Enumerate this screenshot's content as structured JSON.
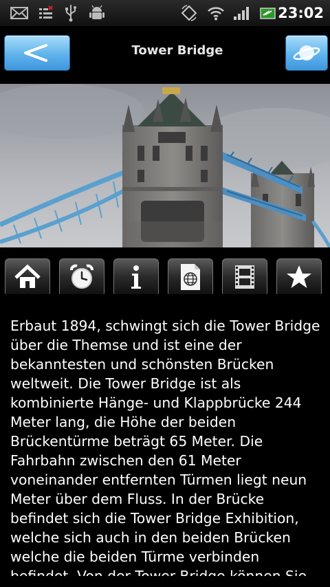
{
  "status_bar": {
    "time": "23:02",
    "icons": [
      "mail-icon",
      "notification-icon",
      "usb-icon",
      "android-debug-icon",
      "screen-rotation-icon",
      "wifi-icon",
      "signal-icon",
      "battery-icon"
    ]
  },
  "header": {
    "title": "Tower Bridge",
    "back_icon": "back-arrow-icon",
    "web_icon": "planet-icon"
  },
  "photo": {
    "subject": "Tower Bridge"
  },
  "tabs": [
    {
      "icon": "home-icon"
    },
    {
      "icon": "alarm-clock-icon"
    },
    {
      "icon": "info-icon"
    },
    {
      "icon": "web-document-icon"
    },
    {
      "icon": "film-strip-icon"
    },
    {
      "icon": "star-icon"
    }
  ],
  "content": {
    "text": "Erbaut 1894, schwingt sich die Tower Bridge über die Themse und ist eine der bekanntesten und schönsten Brücken weltweit. Die Tower Bridge ist als kombinierte Hänge- und Klappbrücke 244 Meter lang, die Höhe der beiden Brückentürme beträgt 65 Meter. Die Fahrbahn zwischen den 61 Meter voneinander entfernten Türmen liegt neun Meter über dem Fluss. In der Brücke befindet sich die Tower Bridge Exhibition, welche sich auch in den beiden Brücken welche die beiden Türme verbinden befindet. Von der Tower Bridge können Sie"
  }
}
